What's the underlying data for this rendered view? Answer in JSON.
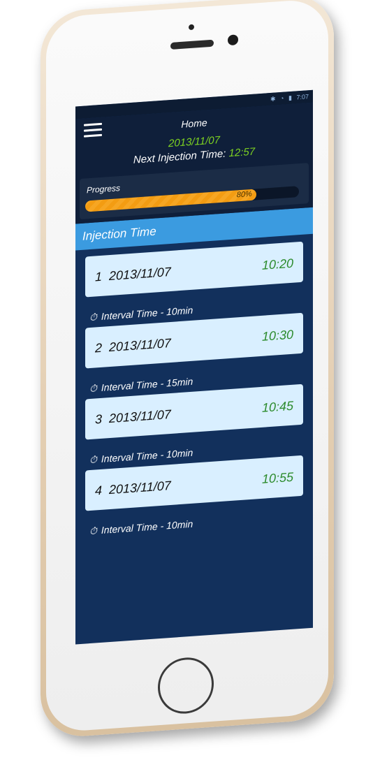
{
  "status": {
    "time": "7:07"
  },
  "header": {
    "title": "Home",
    "date": "2013/11/07",
    "next_label": "Next Injection Time:",
    "next_time": "12:57"
  },
  "progress": {
    "label": "Progress",
    "value_text": "80%",
    "value": 0.8
  },
  "section": {
    "title": "Injection Time"
  },
  "injections": [
    {
      "num": "1",
      "date": "2013/11/07",
      "time": "10:20"
    },
    {
      "num": "2",
      "date": "2013/11/07",
      "time": "10:30"
    },
    {
      "num": "3",
      "date": "2013/11/07",
      "time": "10:45"
    },
    {
      "num": "4",
      "date": "2013/11/07",
      "time": "10:55"
    }
  ],
  "intervals": [
    "Interval Time - 10min",
    "Interval Time - 15min",
    "Interval Time - 10min",
    "Interval Time - 10min"
  ]
}
